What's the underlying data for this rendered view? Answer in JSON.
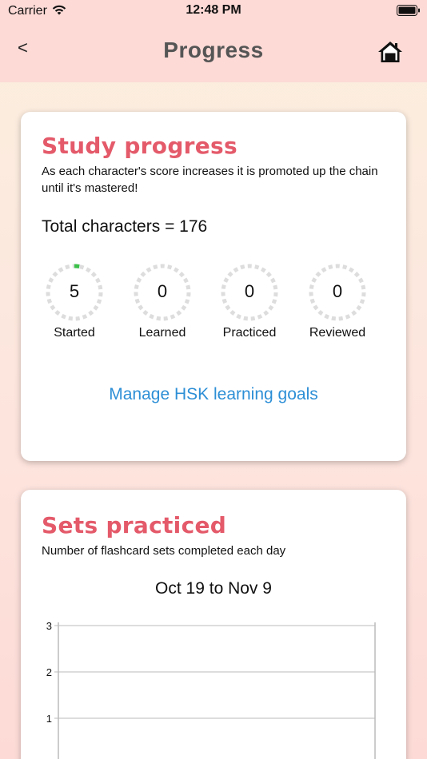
{
  "status": {
    "carrier": "Carrier",
    "time": "12:48 PM"
  },
  "nav": {
    "back_label": "<",
    "title": "Progress"
  },
  "study": {
    "title": "Study progress",
    "description": "As each character's score increases it is promoted up the chain until it's mastered!",
    "total": "Total characters = 176",
    "stats": [
      {
        "value": "5",
        "label": "Started",
        "progress": 0.03
      },
      {
        "value": "0",
        "label": "Learned",
        "progress": 0
      },
      {
        "value": "0",
        "label": "Practiced",
        "progress": 0
      },
      {
        "value": "0",
        "label": "Reviewed",
        "progress": 0
      }
    ],
    "manage_link": "Manage HSK learning goals"
  },
  "sets": {
    "title": "Sets practiced",
    "description": "Number of flashcard sets completed each day",
    "range": "Oct 19 to Nov 9"
  },
  "colors": {
    "accent": "#e45a6a",
    "link": "#2d8fd6",
    "ring_progress": "#3cc04a",
    "ring_track": "#dddddd"
  },
  "chart_data": {
    "type": "bar",
    "title": "Oct 19 to Nov 9",
    "yticks": [
      3,
      2,
      1
    ],
    "ylim": [
      0,
      3
    ],
    "values": [],
    "grid": true
  }
}
